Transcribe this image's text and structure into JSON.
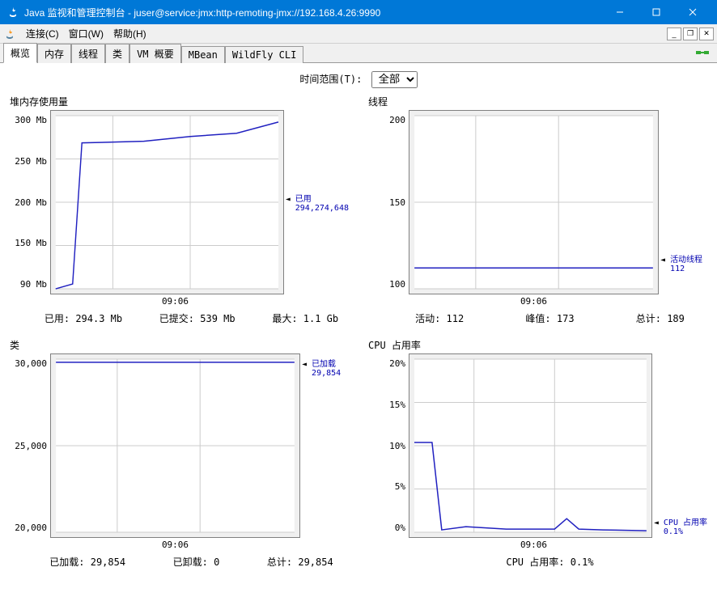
{
  "title": "Java 监视和管理控制台 - juser@service:jmx:http-remoting-jmx://192.168.4.26:9990",
  "menu": {
    "connect": "连接(C)",
    "window": "窗口(W)",
    "help": "帮助(H)"
  },
  "tabs": [
    "概览",
    "内存",
    "线程",
    "类",
    "VM 概要",
    "MBean",
    "WildFly CLI"
  ],
  "time_range": {
    "label": "时间范围(T):",
    "value": "全部",
    "options": [
      "全部"
    ]
  },
  "heap": {
    "title": "堆内存使用量",
    "y_ticks": [
      "300 Mb",
      "250 Mb",
      "200 Mb",
      "150 Mb",
      "90 Mb"
    ],
    "x_label": "09:06",
    "legend": {
      "l1": "已用",
      "l2": "294,274,648"
    },
    "stats": {
      "used_l": "已用:",
      "used_v": "294.3 Mb",
      "commit_l": "已提交:",
      "commit_v": "539 Mb",
      "max_l": "最大:",
      "max_v": "1.1 Gb"
    }
  },
  "threads": {
    "title": "线程",
    "y_ticks": [
      "200",
      "150",
      "100"
    ],
    "x_label": "09:06",
    "legend": {
      "l1": "活动线程",
      "l2": "112"
    },
    "stats": {
      "live_l": "活动:",
      "live_v": "112",
      "peak_l": "峰值:",
      "peak_v": "173",
      "total_l": "总计:",
      "total_v": "189"
    }
  },
  "classes": {
    "title": "类",
    "y_ticks": [
      "30,000",
      "25,000",
      "20,000"
    ],
    "x_label": "09:06",
    "legend": {
      "l1": "已加载",
      "l2": "29,854"
    },
    "stats": {
      "loaded_l": "已加载:",
      "loaded_v": "29,854",
      "unloaded_l": "已卸载:",
      "unloaded_v": "0",
      "total_l": "总计:",
      "total_v": "29,854"
    }
  },
  "cpu": {
    "title": "CPU 占用率",
    "y_ticks": [
      "20%",
      "15%",
      "10%",
      "5%",
      "0%"
    ],
    "x_label": "09:06",
    "legend": {
      "l1": "CPU 占用率",
      "l2": "0.1%"
    },
    "stats": {
      "l": "CPU 占用率:",
      "v": "0.1%"
    }
  },
  "chart_data": [
    {
      "type": "line",
      "title": "堆内存使用量",
      "xlabel": "09:06",
      "ylabel": "Mb",
      "ylim": [
        90,
        300
      ],
      "x": [
        0,
        0.08,
        0.12,
        0.4,
        0.6,
        0.8,
        1.0
      ],
      "values": [
        90,
        95,
        268,
        272,
        278,
        282,
        294
      ],
      "series_name": "已用",
      "current": 294274648
    },
    {
      "type": "line",
      "title": "线程",
      "xlabel": "09:06",
      "ylim": [
        100,
        200
      ],
      "x": [
        0,
        1.0
      ],
      "values": [
        112,
        112
      ],
      "series_name": "活动线程",
      "current": 112
    },
    {
      "type": "line",
      "title": "类",
      "xlabel": "09:06",
      "ylim": [
        20000,
        30000
      ],
      "x": [
        0,
        1.0
      ],
      "values": [
        29854,
        29854
      ],
      "series_name": "已加载",
      "current": 29854
    },
    {
      "type": "line",
      "title": "CPU 占用率",
      "xlabel": "09:06",
      "ylabel": "%",
      "ylim": [
        0,
        20
      ],
      "x": [
        0,
        0.08,
        0.12,
        0.2,
        0.4,
        0.6,
        0.65,
        0.7,
        0.8,
        1.0
      ],
      "values": [
        10.4,
        10.4,
        0.2,
        0.5,
        0.3,
        0.3,
        1.5,
        0.3,
        0.2,
        0.1
      ],
      "series_name": "CPU 占用率",
      "current": 0.1
    }
  ]
}
